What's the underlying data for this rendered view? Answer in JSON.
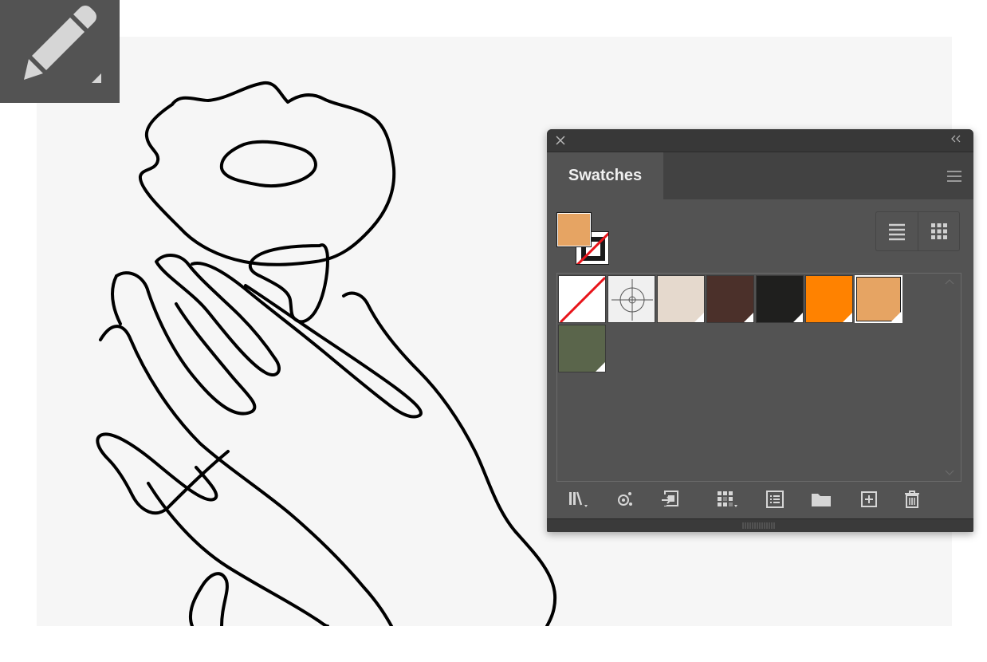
{
  "tool": {
    "name": "pencil-tool",
    "icon": "pencil-icon"
  },
  "panel": {
    "close_icon": "close-icon",
    "collapse_icon": "collapse-icon",
    "tab_label": "Swatches",
    "menu_icon": "hamburger-menu-icon",
    "fill_color": "#e6a463",
    "stroke": "none",
    "view_modes": [
      "list-view",
      "grid-view"
    ],
    "active_view": "grid-view",
    "swatches": [
      {
        "name": "none",
        "color": "#ffffff"
      },
      {
        "name": "registration",
        "color": "#f0f0f0"
      },
      {
        "name": "light-beige",
        "color": "#e5d9cd"
      },
      {
        "name": "dark-brown",
        "color": "#4b302a"
      },
      {
        "name": "black",
        "color": "#1f1f1e"
      },
      {
        "name": "orange",
        "color": "#ff8200"
      },
      {
        "name": "tan",
        "color": "#e6a463",
        "selected": true
      },
      {
        "name": "olive-green",
        "color": "#5a654b"
      }
    ],
    "toolbar_icons": [
      "swatch-libraries-icon",
      "show-kinds-icon",
      "import-swatches-icon",
      "new-color-group-icon",
      "swatch-options-icon",
      "folder-icon",
      "new-swatch-icon",
      "delete-swatch-icon"
    ]
  }
}
